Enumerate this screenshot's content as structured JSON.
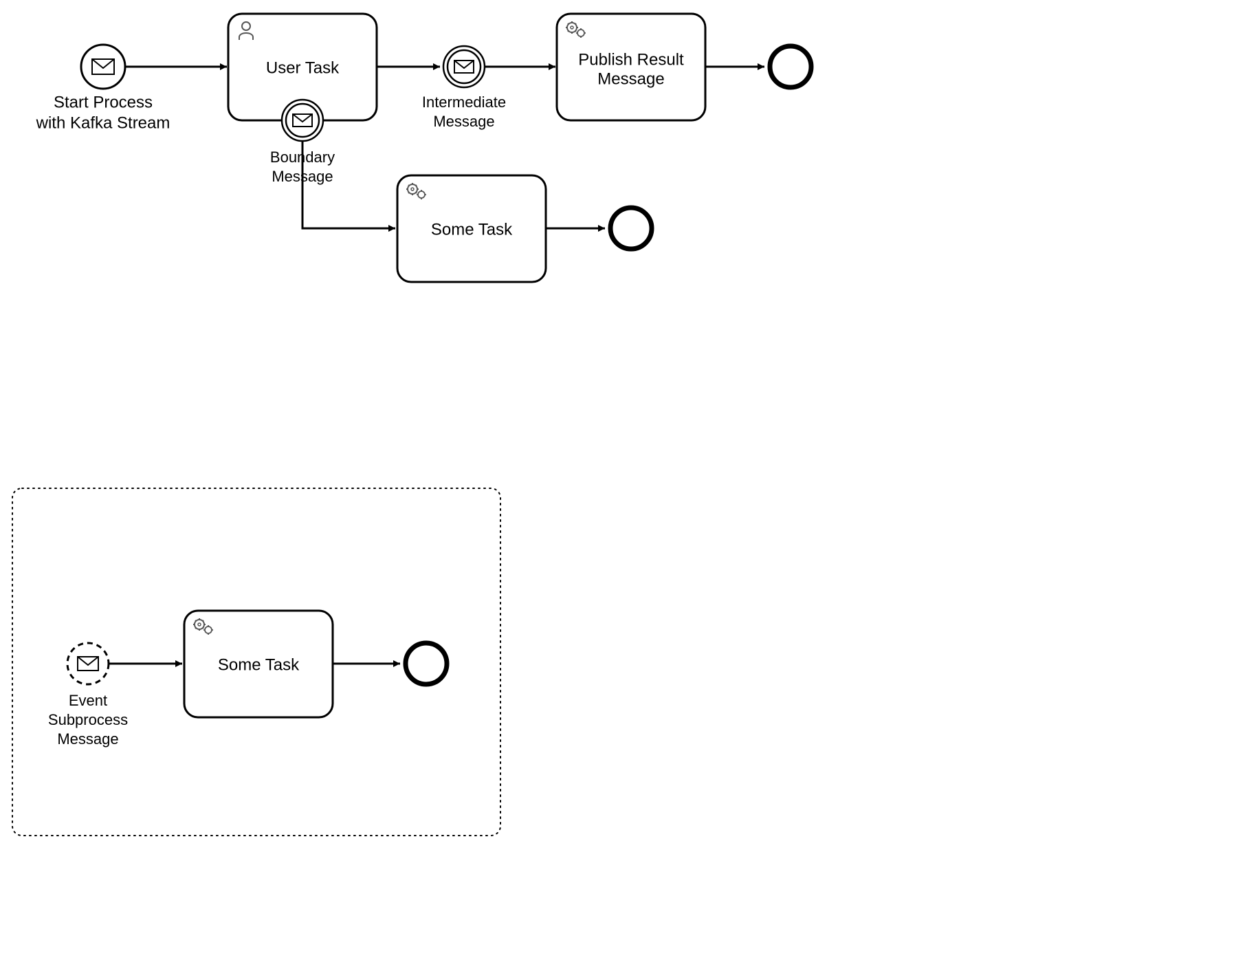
{
  "diagram": {
    "startEvent": {
      "label1": "Start Process",
      "label2": "with Kafka Stream"
    },
    "userTask": {
      "label": "User Task"
    },
    "boundaryMessage": {
      "label1": "Boundary",
      "label2": "Message"
    },
    "intermediateMessage": {
      "label1": "Intermediate",
      "label2": "Message"
    },
    "publishTask": {
      "label1": "Publish Result",
      "label2": "Message"
    },
    "someTask": {
      "label": "Some Task"
    },
    "subprocess": {
      "startEvent": {
        "label1": "Event",
        "label2": "Subprocess",
        "label3": "Message"
      },
      "someTask": {
        "label": "Some Task"
      }
    }
  }
}
